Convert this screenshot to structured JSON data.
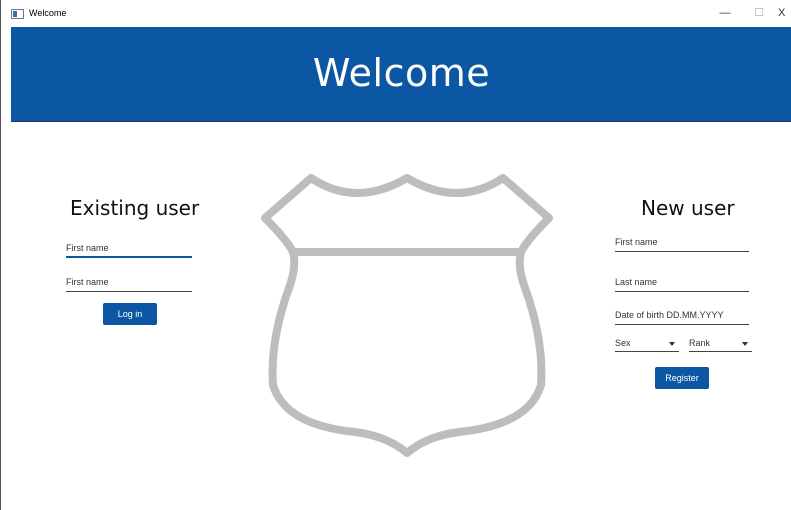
{
  "window": {
    "title": "Welcome",
    "minimize_glyph": "—",
    "maximize_glyph": "☐",
    "close_glyph": "X"
  },
  "header": {
    "title": "Welcome"
  },
  "existing_user": {
    "title": "Existing user",
    "first_name_placeholder": "First name",
    "second_field_placeholder": "First name",
    "login_label": "Log in"
  },
  "new_user": {
    "title": "New user",
    "first_name_placeholder": "First name",
    "last_name_placeholder": "Last name",
    "dob_placeholder": "Date of birth DD.MM.YYYY",
    "sex_label": "Sex",
    "rank_label": "Rank",
    "register_label": "Register"
  },
  "colors": {
    "header_bg": "#0b57a3",
    "button_bg": "#0b57a3",
    "shield_stroke": "#bdbdbd"
  },
  "icons": {
    "logo": "shield-icon"
  }
}
